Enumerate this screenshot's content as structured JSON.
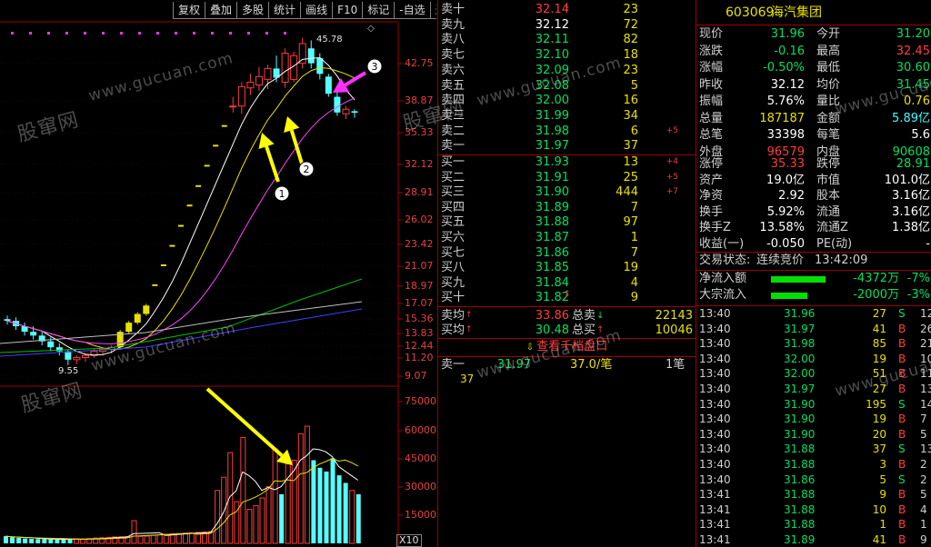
{
  "toolbar": {
    "buttons": [
      "复权",
      "叠加",
      "多股",
      "统计",
      "画线",
      "F10",
      "标记",
      "-自选",
      "返回"
    ]
  },
  "chart_data": {
    "type": "candlestick",
    "price_axis": {
      "ticks": [
        "42.75",
        "38.87",
        "35.33",
        "32.12",
        "28.91",
        "26.02",
        "23.42",
        "21.07",
        "18.97",
        "17.07",
        "15.36",
        "13.83",
        "12.44",
        "11.20",
        "9.07"
      ],
      "range": [
        8.9,
        47.5
      ],
      "scale": "log"
    },
    "volume_axis": {
      "ticks": [
        "75000",
        "60000",
        "45000",
        "30000",
        "15000"
      ],
      "range": [
        0,
        75000
      ],
      "unit": "X10"
    },
    "annotations": {
      "high": "45.78",
      "low": "9.55"
    },
    "candles": [
      {
        "o": 11.9,
        "h": 12.1,
        "l": 11.6,
        "c": 11.8
      },
      {
        "o": 11.8,
        "h": 12.0,
        "l": 11.3,
        "c": 11.5
      },
      {
        "o": 11.5,
        "h": 11.7,
        "l": 11.0,
        "c": 11.2
      },
      {
        "o": 11.2,
        "h": 11.5,
        "l": 10.8,
        "c": 11.0
      },
      {
        "o": 11.0,
        "h": 11.2,
        "l": 10.5,
        "c": 10.7
      },
      {
        "o": 10.7,
        "h": 10.9,
        "l": 10.2,
        "c": 10.4
      },
      {
        "o": 10.4,
        "h": 10.6,
        "l": 10.0,
        "c": 10.2
      },
      {
        "o": 10.2,
        "h": 10.3,
        "l": 9.55,
        "c": 9.8
      },
      {
        "o": 9.8,
        "h": 10.0,
        "l": 9.6,
        "c": 9.9
      },
      {
        "o": 9.9,
        "h": 10.1,
        "l": 9.7,
        "c": 10.0
      },
      {
        "o": 10.0,
        "h": 10.3,
        "l": 9.9,
        "c": 10.2
      },
      {
        "o": 10.2,
        "h": 10.4,
        "l": 10.0,
        "c": 10.3
      },
      {
        "o": 10.3,
        "h": 10.5,
        "l": 10.1,
        "c": 10.4
      },
      {
        "o": 10.4,
        "h": 11.3,
        "l": 10.3,
        "c": 11.2
      },
      {
        "o": 11.2,
        "h": 11.8,
        "l": 11.1,
        "c": 11.7
      },
      {
        "o": 11.7,
        "h": 12.3,
        "l": 11.6,
        "c": 12.2
      },
      {
        "o": 12.2,
        "h": 12.8,
        "l": 12.1,
        "c": 12.7
      },
      {
        "o": 12.7,
        "h": 14.0,
        "l": 12.6,
        "c": 14.0
      },
      {
        "o": 14.0,
        "h": 15.4,
        "l": 13.9,
        "c": 15.4
      },
      {
        "o": 15.4,
        "h": 16.9,
        "l": 15.3,
        "c": 16.9
      },
      {
        "o": 16.9,
        "h": 18.6,
        "l": 16.8,
        "c": 18.6
      },
      {
        "o": 18.6,
        "h": 20.5,
        "l": 18.5,
        "c": 20.5
      },
      {
        "o": 20.5,
        "h": 22.5,
        "l": 20.4,
        "c": 22.5
      },
      {
        "o": 22.5,
        "h": 24.8,
        "l": 22.4,
        "c": 24.8
      },
      {
        "o": 24.8,
        "h": 27.3,
        "l": 24.7,
        "c": 27.3
      },
      {
        "o": 27.3,
        "h": 30.0,
        "l": 27.2,
        "c": 30.0
      },
      {
        "o": 33.0,
        "h": 34.5,
        "l": 32.0,
        "c": 33.0
      },
      {
        "o": 33.0,
        "h": 37.0,
        "l": 31.8,
        "c": 36.2
      },
      {
        "o": 36.0,
        "h": 38.5,
        "l": 34.8,
        "c": 37.0
      },
      {
        "o": 36.5,
        "h": 39.8,
        "l": 35.5,
        "c": 38.0
      },
      {
        "o": 37.5,
        "h": 40.2,
        "l": 35.8,
        "c": 39.5
      },
      {
        "o": 39.5,
        "h": 42.0,
        "l": 37.0,
        "c": 37.8
      },
      {
        "o": 37.0,
        "h": 43.5,
        "l": 36.0,
        "c": 42.5
      },
      {
        "o": 37.5,
        "h": 42.8,
        "l": 37.0,
        "c": 42.0
      },
      {
        "o": 40.5,
        "h": 45.78,
        "l": 39.5,
        "c": 44.5
      },
      {
        "o": 43.5,
        "h": 45.2,
        "l": 39.5,
        "c": 40.5
      },
      {
        "o": 41.5,
        "h": 42.5,
        "l": 37.5,
        "c": 38.5
      },
      {
        "o": 38.0,
        "h": 38.5,
        "l": 34.5,
        "c": 35.0
      },
      {
        "o": 34.5,
        "h": 35.5,
        "l": 31.5,
        "c": 32.0
      },
      {
        "o": 31.8,
        "h": 33.0,
        "l": 31.0,
        "c": 32.5
      },
      {
        "o": 32.2,
        "h": 32.5,
        "l": 31.2,
        "c": 31.96
      }
    ],
    "volumes": [
      3800,
      3200,
      2900,
      2600,
      2400,
      2300,
      2200,
      2100,
      2000,
      2200,
      2400,
      2300,
      2100,
      2500,
      2800,
      3000,
      3200,
      3400,
      3500,
      3600,
      12000,
      3700,
      3800,
      4200,
      4500,
      4800,
      5000,
      5200,
      5400,
      5600,
      5800,
      6000,
      6200,
      28000,
      35000,
      48000,
      22000,
      56000,
      18000,
      20000,
      24000,
      30000,
      50000,
      26000,
      42000,
      44000,
      58000,
      62000,
      44000,
      40000,
      38000,
      45000,
      36000,
      32000,
      28000,
      26000
    ],
    "annotation_labels": [
      "1",
      "2",
      "3"
    ],
    "colors": {
      "up": "#ff3c3c",
      "down": "#54ffff",
      "limit_up": "#e8e000",
      "ma5": "#ffffff",
      "ma10": "#e8e000",
      "ma20": "#ff40ff",
      "ma60": "#00c000",
      "ma120": "#c0c0c0",
      "ma250": "#4040ff",
      "arrow_yellow": "#ffff00",
      "arrow_magenta": "#ff30ff"
    }
  },
  "watermark": {
    "brand": "股窜网",
    "url": "www.gucuan.com"
  },
  "order_book": {
    "asks": [
      {
        "label": "卖十",
        "price": "32.14",
        "vol": "23",
        "mark": "↓",
        "pc": "up"
      },
      {
        "label": "卖九",
        "price": "32.12",
        "vol": "72",
        "mark": "",
        "pc": "wh"
      },
      {
        "label": "卖八",
        "price": "32.11",
        "vol": "82",
        "mark": "",
        "pc": "dn"
      },
      {
        "label": "卖七",
        "price": "32.10",
        "vol": "18",
        "mark": "",
        "pc": "dn"
      },
      {
        "label": "卖六",
        "price": "32.09",
        "vol": "23",
        "mark": "",
        "pc": "dn"
      },
      {
        "label": "卖五",
        "price": "32.08",
        "vol": "5",
        "mark": "",
        "pc": "dn"
      },
      {
        "label": "卖四",
        "price": "32.00",
        "vol": "16",
        "mark": "",
        "pc": "dn"
      },
      {
        "label": "卖三",
        "price": "31.99",
        "vol": "34",
        "mark": "",
        "pc": "dn"
      },
      {
        "label": "卖二",
        "price": "31.98",
        "vol": "6",
        "mark": "",
        "pc": "dn",
        "chg": "+5"
      },
      {
        "label": "卖一",
        "price": "31.97",
        "vol": "37",
        "mark": "",
        "pc": "dn"
      }
    ],
    "bids": [
      {
        "label": "买一",
        "price": "31.93",
        "vol": "13",
        "mark": "",
        "pc": "dn",
        "chg": "+4"
      },
      {
        "label": "买二",
        "price": "31.91",
        "vol": "25",
        "mark": "",
        "pc": "dn",
        "chg": "+5"
      },
      {
        "label": "买三",
        "price": "31.90",
        "vol": "444",
        "mark": "",
        "pc": "dn",
        "chg": "+7"
      },
      {
        "label": "买四",
        "price": "31.89",
        "vol": "7",
        "mark": "",
        "pc": "dn"
      },
      {
        "label": "买五",
        "price": "31.88",
        "vol": "97",
        "mark": "",
        "pc": "dn"
      },
      {
        "label": "买六",
        "price": "31.87",
        "vol": "1",
        "mark": "",
        "pc": "dn"
      },
      {
        "label": "买七",
        "price": "31.86",
        "vol": "7",
        "mark": "",
        "pc": "dn"
      },
      {
        "label": "买八",
        "price": "31.85",
        "vol": "19",
        "mark": "",
        "pc": "dn"
      },
      {
        "label": "买九",
        "price": "31.84",
        "vol": "4",
        "mark": "",
        "pc": "dn"
      },
      {
        "label": "买十",
        "price": "31.82",
        "vol": "9",
        "mark": "↕",
        "pc": "dn"
      }
    ],
    "ask_avg": {
      "label": "卖均",
      "arrow": "↑",
      "price": "33.86",
      "total_label": "总卖",
      "total_arrow": "↓",
      "total": "22143"
    },
    "bid_avg": {
      "label": "买均",
      "arrow": "↑",
      "price": "30.48",
      "total_label": "总买",
      "total_arrow": "↑",
      "total": "10046"
    },
    "view_button": "查看千档盘口",
    "sell1_detail": {
      "label": "卖一",
      "price": "31.97",
      "qty": "37.0/笔",
      "count": "1笔",
      "sub": "37"
    }
  },
  "quote": {
    "code": "603069",
    "name": "海汽集团",
    "rows": [
      {
        "l1": "现价",
        "v1": "31.96",
        "c1": "dn",
        "l2": "今开",
        "v2": "31.20",
        "c2": "dn"
      },
      {
        "l1": "涨跌",
        "v1": "-0.16",
        "c1": "dn",
        "l2": "最高",
        "v2": "32.45",
        "c2": "up"
      },
      {
        "l1": "涨幅",
        "v1": "-0.50%",
        "c1": "dn",
        "l2": "最低",
        "v2": "30.60",
        "c2": "dn"
      },
      {
        "l1": "昨收",
        "v1": "32.12",
        "c1": "wh",
        "l2": "均价",
        "v2": "31.45",
        "c2": "dn"
      },
      {
        "l1": "振幅",
        "v1": "5.76%",
        "c1": "wh",
        "l2": "量比",
        "v2": "0.76",
        "c2": "yl"
      },
      {
        "l1": "总量",
        "v1": "187187",
        "c1": "yl",
        "l2": "金额",
        "v2": "5.89亿",
        "c2": "cy"
      },
      {
        "l1": "总笔",
        "v1": "33398",
        "c1": "wh",
        "l2": "每笔",
        "v2": "5.6",
        "c2": "wh"
      },
      {
        "l1": "外盘",
        "v1": "96579",
        "c1": "up",
        "l2": "内盘",
        "v2": "90608",
        "c2": "dn"
      },
      {
        "l1": "涨停",
        "v1": "35.33",
        "c1": "up",
        "l2": "跌停",
        "v2": "28.91",
        "c2": "dn"
      },
      {
        "l1": "资产",
        "v1": "19.0亿",
        "c1": "wh",
        "l2": "市值",
        "v2": "101.0亿",
        "c2": "wh"
      },
      {
        "l1": "净资",
        "v1": "2.92",
        "c1": "wh",
        "l2": "股本",
        "v2": "3.16亿",
        "c2": "wh"
      },
      {
        "l1": "换手",
        "v1": "5.92%",
        "c1": "wh",
        "l2": "流通",
        "v2": "3.16亿",
        "c2": "wh"
      },
      {
        "l1": "换手Z",
        "v1": "13.58%",
        "c1": "wh",
        "l2": "流通Z",
        "v2": "1.38亿",
        "c2": "wh"
      },
      {
        "l1": "收益(一)",
        "v1": "-0.050",
        "c1": "wh",
        "l2": "PE(动)",
        "v2": "-",
        "c2": "wh"
      }
    ],
    "status": {
      "label": "交易状态:",
      "value": "连续竞价",
      "time": "13:42:09"
    },
    "flows": [
      {
        "label": "净流入额",
        "bar": 0.6,
        "value": "-4372万",
        "pct": "-7%"
      },
      {
        "label": "大宗流入",
        "bar": 0.4,
        "value": "-2000万",
        "pct": "-3%"
      }
    ],
    "ticks": [
      {
        "t": "13:40",
        "p": "31.96",
        "pc": "dn",
        "v": "27",
        "s": "S",
        "n": "12"
      },
      {
        "t": "13:40",
        "p": "31.97",
        "pc": "dn",
        "v": "41",
        "s": "B",
        "n": "26"
      },
      {
        "t": "13:40",
        "p": "31.98",
        "pc": "dn",
        "v": "85",
        "s": "B",
        "n": "21"
      },
      {
        "t": "13:40",
        "p": "32.00",
        "pc": "dn",
        "v": "19",
        "s": "B",
        "n": "10"
      },
      {
        "t": "13:40",
        "p": "32.00",
        "pc": "dn",
        "v": "51",
        "s": "B",
        "n": "11"
      },
      {
        "t": "13:40",
        "p": "31.97",
        "pc": "dn",
        "v": "27",
        "s": "B",
        "n": "13"
      },
      {
        "t": "13:40",
        "p": "31.90",
        "pc": "dn",
        "v": "195",
        "s": "S",
        "n": "14"
      },
      {
        "t": "13:40",
        "p": "31.90",
        "pc": "dn",
        "v": "19",
        "s": "B",
        "n": "7"
      },
      {
        "t": "13:40",
        "p": "31.90",
        "pc": "dn",
        "v": "20",
        "s": "B",
        "n": "5"
      },
      {
        "t": "13:40",
        "p": "31.88",
        "pc": "dn",
        "v": "37",
        "s": "S",
        "n": "13"
      },
      {
        "t": "13:40",
        "p": "31.88",
        "pc": "dn",
        "v": "3",
        "s": "B",
        "n": "2"
      },
      {
        "t": "13:40",
        "p": "31.86",
        "pc": "dn",
        "v": "5",
        "s": "S",
        "n": "2"
      },
      {
        "t": "13:41",
        "p": "31.88",
        "pc": "dn",
        "v": "9",
        "s": "B",
        "n": "5"
      },
      {
        "t": "13:41",
        "p": "31.88",
        "pc": "dn",
        "v": "10",
        "s": "B",
        "n": "4"
      },
      {
        "t": "13:41",
        "p": "31.88",
        "pc": "dn",
        "v": "1",
        "s": "B",
        "n": "1"
      },
      {
        "t": "13:41",
        "p": "31.89",
        "pc": "dn",
        "v": "41",
        "s": "B",
        "n": "9"
      }
    ]
  }
}
